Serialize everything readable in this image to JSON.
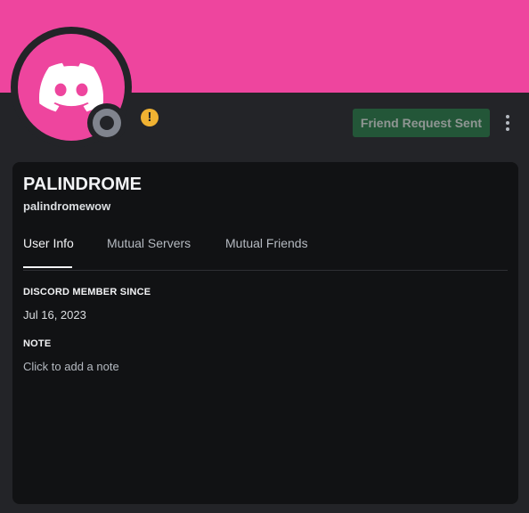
{
  "profile": {
    "display_name": "PALINDROME",
    "username": "palindromewow",
    "banner_color": "#ee459e",
    "avatar_icon": "discord-logo-icon",
    "status": "offline",
    "warning_icon": "warning-icon"
  },
  "actions": {
    "friend_request_label": "Friend Request Sent",
    "more_icon": "more-vertical-icon"
  },
  "tabs": [
    {
      "label": "User Info",
      "active": true
    },
    {
      "label": "Mutual Servers",
      "active": false
    },
    {
      "label": "Mutual Friends",
      "active": false
    }
  ],
  "info": {
    "member_since_title": "DISCORD MEMBER SINCE",
    "member_since_value": "Jul 16, 2023",
    "note_title": "NOTE",
    "note_placeholder": "Click to add a note"
  }
}
